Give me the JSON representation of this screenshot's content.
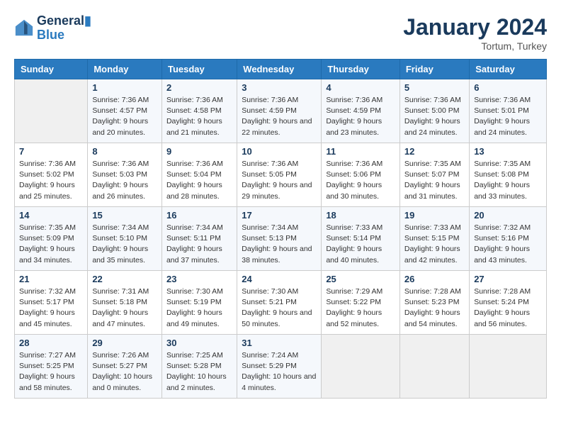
{
  "header": {
    "logo_line1": "General",
    "logo_line2": "Blue",
    "month": "January 2024",
    "location": "Tortum, Turkey"
  },
  "days_of_week": [
    "Sunday",
    "Monday",
    "Tuesday",
    "Wednesday",
    "Thursday",
    "Friday",
    "Saturday"
  ],
  "weeks": [
    [
      {
        "num": "",
        "sunrise": "",
        "sunset": "",
        "daylight": ""
      },
      {
        "num": "1",
        "sunrise": "Sunrise: 7:36 AM",
        "sunset": "Sunset: 4:57 PM",
        "daylight": "Daylight: 9 hours and 20 minutes."
      },
      {
        "num": "2",
        "sunrise": "Sunrise: 7:36 AM",
        "sunset": "Sunset: 4:58 PM",
        "daylight": "Daylight: 9 hours and 21 minutes."
      },
      {
        "num": "3",
        "sunrise": "Sunrise: 7:36 AM",
        "sunset": "Sunset: 4:59 PM",
        "daylight": "Daylight: 9 hours and 22 minutes."
      },
      {
        "num": "4",
        "sunrise": "Sunrise: 7:36 AM",
        "sunset": "Sunset: 4:59 PM",
        "daylight": "Daylight: 9 hours and 23 minutes."
      },
      {
        "num": "5",
        "sunrise": "Sunrise: 7:36 AM",
        "sunset": "Sunset: 5:00 PM",
        "daylight": "Daylight: 9 hours and 24 minutes."
      },
      {
        "num": "6",
        "sunrise": "Sunrise: 7:36 AM",
        "sunset": "Sunset: 5:01 PM",
        "daylight": "Daylight: 9 hours and 24 minutes."
      }
    ],
    [
      {
        "num": "7",
        "sunrise": "Sunrise: 7:36 AM",
        "sunset": "Sunset: 5:02 PM",
        "daylight": "Daylight: 9 hours and 25 minutes."
      },
      {
        "num": "8",
        "sunrise": "Sunrise: 7:36 AM",
        "sunset": "Sunset: 5:03 PM",
        "daylight": "Daylight: 9 hours and 26 minutes."
      },
      {
        "num": "9",
        "sunrise": "Sunrise: 7:36 AM",
        "sunset": "Sunset: 5:04 PM",
        "daylight": "Daylight: 9 hours and 28 minutes."
      },
      {
        "num": "10",
        "sunrise": "Sunrise: 7:36 AM",
        "sunset": "Sunset: 5:05 PM",
        "daylight": "Daylight: 9 hours and 29 minutes."
      },
      {
        "num": "11",
        "sunrise": "Sunrise: 7:36 AM",
        "sunset": "Sunset: 5:06 PM",
        "daylight": "Daylight: 9 hours and 30 minutes."
      },
      {
        "num": "12",
        "sunrise": "Sunrise: 7:35 AM",
        "sunset": "Sunset: 5:07 PM",
        "daylight": "Daylight: 9 hours and 31 minutes."
      },
      {
        "num": "13",
        "sunrise": "Sunrise: 7:35 AM",
        "sunset": "Sunset: 5:08 PM",
        "daylight": "Daylight: 9 hours and 33 minutes."
      }
    ],
    [
      {
        "num": "14",
        "sunrise": "Sunrise: 7:35 AM",
        "sunset": "Sunset: 5:09 PM",
        "daylight": "Daylight: 9 hours and 34 minutes."
      },
      {
        "num": "15",
        "sunrise": "Sunrise: 7:34 AM",
        "sunset": "Sunset: 5:10 PM",
        "daylight": "Daylight: 9 hours and 35 minutes."
      },
      {
        "num": "16",
        "sunrise": "Sunrise: 7:34 AM",
        "sunset": "Sunset: 5:11 PM",
        "daylight": "Daylight: 9 hours and 37 minutes."
      },
      {
        "num": "17",
        "sunrise": "Sunrise: 7:34 AM",
        "sunset": "Sunset: 5:13 PM",
        "daylight": "Daylight: 9 hours and 38 minutes."
      },
      {
        "num": "18",
        "sunrise": "Sunrise: 7:33 AM",
        "sunset": "Sunset: 5:14 PM",
        "daylight": "Daylight: 9 hours and 40 minutes."
      },
      {
        "num": "19",
        "sunrise": "Sunrise: 7:33 AM",
        "sunset": "Sunset: 5:15 PM",
        "daylight": "Daylight: 9 hours and 42 minutes."
      },
      {
        "num": "20",
        "sunrise": "Sunrise: 7:32 AM",
        "sunset": "Sunset: 5:16 PM",
        "daylight": "Daylight: 9 hours and 43 minutes."
      }
    ],
    [
      {
        "num": "21",
        "sunrise": "Sunrise: 7:32 AM",
        "sunset": "Sunset: 5:17 PM",
        "daylight": "Daylight: 9 hours and 45 minutes."
      },
      {
        "num": "22",
        "sunrise": "Sunrise: 7:31 AM",
        "sunset": "Sunset: 5:18 PM",
        "daylight": "Daylight: 9 hours and 47 minutes."
      },
      {
        "num": "23",
        "sunrise": "Sunrise: 7:30 AM",
        "sunset": "Sunset: 5:19 PM",
        "daylight": "Daylight: 9 hours and 49 minutes."
      },
      {
        "num": "24",
        "sunrise": "Sunrise: 7:30 AM",
        "sunset": "Sunset: 5:21 PM",
        "daylight": "Daylight: 9 hours and 50 minutes."
      },
      {
        "num": "25",
        "sunrise": "Sunrise: 7:29 AM",
        "sunset": "Sunset: 5:22 PM",
        "daylight": "Daylight: 9 hours and 52 minutes."
      },
      {
        "num": "26",
        "sunrise": "Sunrise: 7:28 AM",
        "sunset": "Sunset: 5:23 PM",
        "daylight": "Daylight: 9 hours and 54 minutes."
      },
      {
        "num": "27",
        "sunrise": "Sunrise: 7:28 AM",
        "sunset": "Sunset: 5:24 PM",
        "daylight": "Daylight: 9 hours and 56 minutes."
      }
    ],
    [
      {
        "num": "28",
        "sunrise": "Sunrise: 7:27 AM",
        "sunset": "Sunset: 5:25 PM",
        "daylight": "Daylight: 9 hours and 58 minutes."
      },
      {
        "num": "29",
        "sunrise": "Sunrise: 7:26 AM",
        "sunset": "Sunset: 5:27 PM",
        "daylight": "Daylight: 10 hours and 0 minutes."
      },
      {
        "num": "30",
        "sunrise": "Sunrise: 7:25 AM",
        "sunset": "Sunset: 5:28 PM",
        "daylight": "Daylight: 10 hours and 2 minutes."
      },
      {
        "num": "31",
        "sunrise": "Sunrise: 7:24 AM",
        "sunset": "Sunset: 5:29 PM",
        "daylight": "Daylight: 10 hours and 4 minutes."
      },
      {
        "num": "",
        "sunrise": "",
        "sunset": "",
        "daylight": ""
      },
      {
        "num": "",
        "sunrise": "",
        "sunset": "",
        "daylight": ""
      },
      {
        "num": "",
        "sunrise": "",
        "sunset": "",
        "daylight": ""
      }
    ]
  ]
}
